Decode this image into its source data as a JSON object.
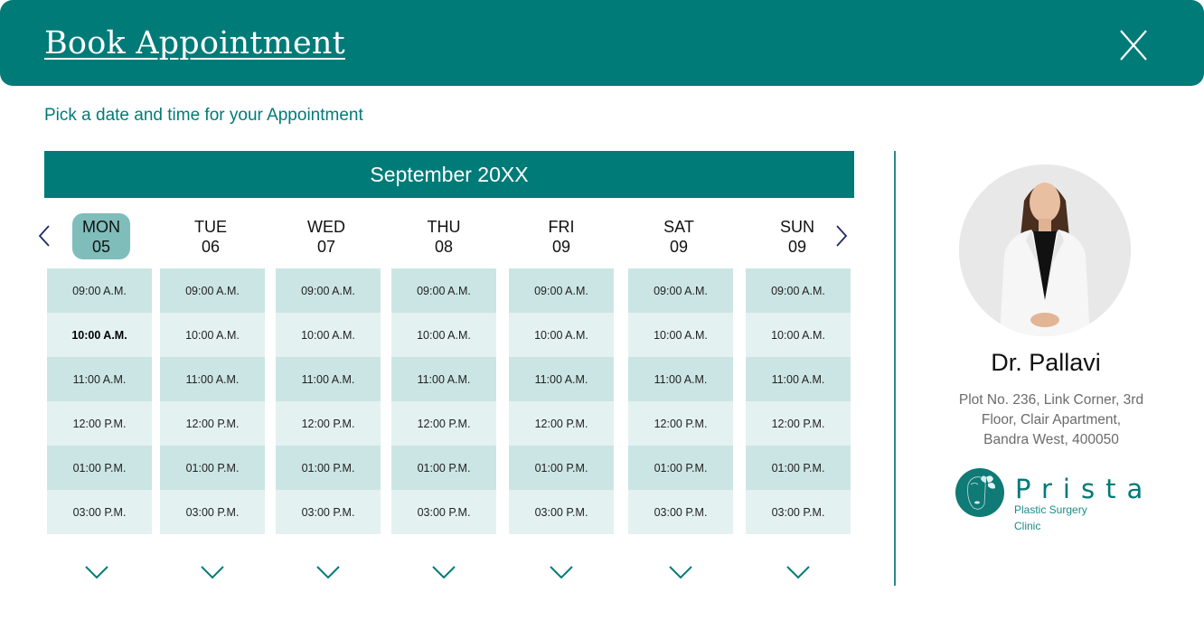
{
  "header": {
    "title": "Book Appointment",
    "close_label": "X"
  },
  "subtitle": "Pick a date and time for your Appointment",
  "calendar": {
    "month": "September 20XX",
    "prev_icon": "chevron-left-icon",
    "next_icon": "chevron-right-icon",
    "days": [
      {
        "day": "MON",
        "date": "05",
        "selected": true
      },
      {
        "day": "TUE",
        "date": "06",
        "selected": false
      },
      {
        "day": "WED",
        "date": "07",
        "selected": false
      },
      {
        "day": "THU",
        "date": "08",
        "selected": false
      },
      {
        "day": "FRI",
        "date": "09",
        "selected": false
      },
      {
        "day": "SAT",
        "date": "09",
        "selected": false
      },
      {
        "day": "SUN",
        "date": "09",
        "selected": false
      }
    ],
    "slots": [
      "09:00 A.M.",
      "10:00 A.M.",
      "11:00 A.M.",
      "12:00 P.M.",
      "01:00 P.M.",
      "03:00 P.M."
    ],
    "selected_slot": {
      "day_index": 0,
      "slot_index": 1
    },
    "more_icon": "chevron-down-icon"
  },
  "doctor": {
    "name": "Dr. Pallavi",
    "address_lines": [
      "Plot No. 236, Link Corner, 3rd",
      "Floor, Clair Apartment,",
      "Bandra West, 400050"
    ]
  },
  "clinic": {
    "name": "Prista",
    "tagline_lines": [
      "Plastic Surgery",
      "Clinic"
    ]
  },
  "colors": {
    "primary": "#007b78",
    "selected_day": "#7fbdbb",
    "slot_dark": "#cbe5e4",
    "slot_light": "#e4f1f1",
    "nav_arrow": "#1f2a6b"
  }
}
